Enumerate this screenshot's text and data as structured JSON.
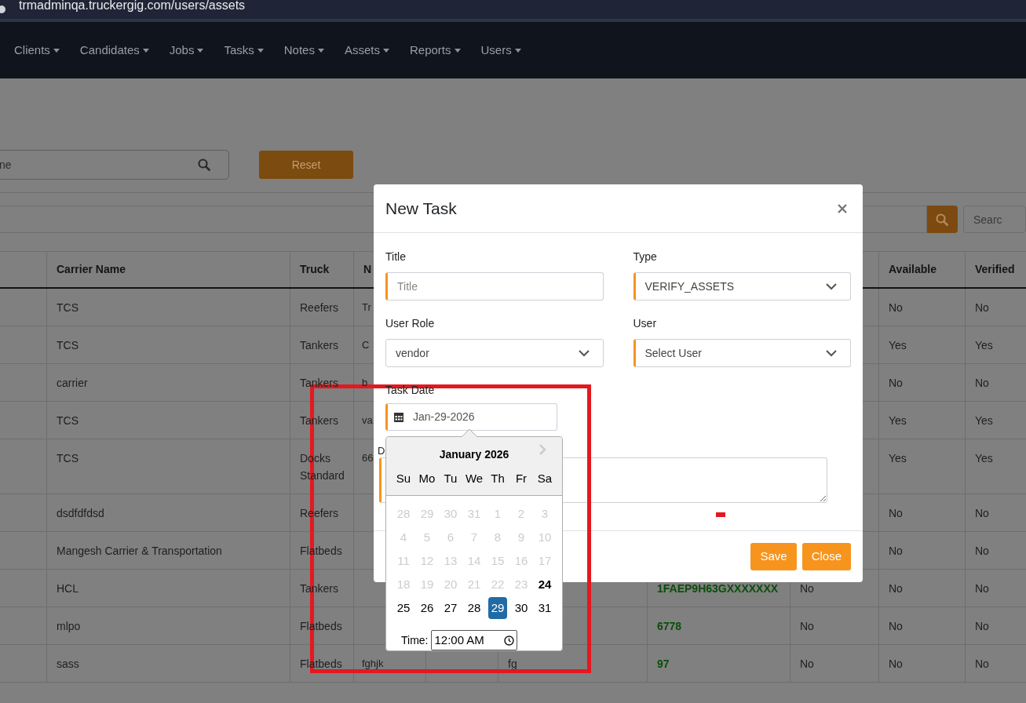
{
  "address_bar": {
    "url": "trmadminqa.truckergig.com/users/assets"
  },
  "nav": {
    "items": [
      {
        "label": "Clients"
      },
      {
        "label": "Candidates"
      },
      {
        "label": "Jobs"
      },
      {
        "label": "Tasks"
      },
      {
        "label": "Notes"
      },
      {
        "label": "Assets"
      },
      {
        "label": "Reports"
      },
      {
        "label": "Users"
      }
    ]
  },
  "filters": {
    "search": {
      "placeholder": "ne"
    },
    "reset_button": "Reset"
  },
  "table_toolbar": {
    "search": {
      "placeholder": "Searc"
    }
  },
  "table": {
    "columns": [
      {},
      {
        "label": "Carrier Name"
      },
      {
        "label": "Truck"
      },
      {
        "label": "N"
      },
      {},
      {},
      {},
      {},
      {
        "label": "Available"
      },
      {
        "label": "Verified"
      }
    ],
    "rows": [
      {
        "cells": [
          null,
          "TCS",
          "Reefers",
          "Tr",
          null,
          null,
          null,
          null,
          "No",
          "No"
        ]
      },
      {
        "cells": [
          null,
          "TCS",
          "Tankers",
          "C",
          null,
          null,
          null,
          null,
          "Yes",
          "Yes"
        ]
      },
      {
        "cells": [
          null,
          "carrier",
          "Tankers",
          "b",
          null,
          null,
          null,
          null,
          "No",
          "No"
        ]
      },
      {
        "cells": [
          null,
          "TCS",
          "Tankers",
          "va",
          null,
          null,
          null,
          null,
          "Yes",
          "Yes"
        ]
      },
      {
        "cells": [
          null,
          "TCS",
          "Docks Standard",
          "66",
          null,
          null,
          null,
          null,
          "Yes",
          "Yes"
        ]
      },
      {
        "cells": [
          null,
          "dsdfdfdsd",
          "Reefers",
          null,
          null,
          null,
          null,
          null,
          "No",
          "No"
        ]
      },
      {
        "cells": [
          null,
          "Mangesh Carrier & Transportation",
          "Flatbeds",
          null,
          null,
          null,
          null,
          null,
          "No",
          "No"
        ]
      },
      {
        "cells": [
          null,
          "HCL",
          "Tankers",
          null,
          null,
          null,
          "1FAEP9H63GXXXXXXX",
          "No",
          "No",
          "No"
        ]
      },
      {
        "cells": [
          null,
          "mlpo",
          "Flatbeds",
          null,
          null,
          null,
          "6778",
          "No",
          "No",
          "No"
        ]
      },
      {
        "cells": [
          null,
          "sass",
          "Flatbeds",
          "fghjk",
          null,
          "fg",
          "97",
          "No",
          "No",
          "No"
        ]
      }
    ]
  },
  "modal": {
    "title": "New Task",
    "fields": [
      {
        "kind": "input",
        "label": "Title",
        "placeholder": "Title",
        "required": true
      },
      {
        "kind": "select",
        "label": "Type",
        "value": "VERIFY_ASSETS",
        "required": true
      },
      {
        "kind": "select",
        "label": "User Role",
        "value": "vendor",
        "required": false
      },
      {
        "kind": "select",
        "label": "User",
        "value": "Select User",
        "required": true
      }
    ],
    "task_date": {
      "label": "Task Date",
      "value": "Jan-29-2026",
      "required": true
    },
    "description": {
      "label": "D",
      "required": true
    },
    "buttons": [
      "Save",
      "Close"
    ]
  },
  "datepicker": {
    "month": "January 2026",
    "weekdays": [
      "Su",
      "Mo",
      "Tu",
      "We",
      "Th",
      "Fr",
      "Sa"
    ],
    "days": [
      {
        "d": "28",
        "disabled": true,
        "today": false,
        "selected": false
      },
      {
        "d": "29",
        "disabled": true,
        "today": false,
        "selected": false
      },
      {
        "d": "30",
        "disabled": true,
        "today": false,
        "selected": false
      },
      {
        "d": "31",
        "disabled": true,
        "today": false,
        "selected": false
      },
      {
        "d": "1",
        "disabled": true,
        "today": false,
        "selected": false
      },
      {
        "d": "2",
        "disabled": true,
        "today": false,
        "selected": false
      },
      {
        "d": "3",
        "disabled": true,
        "today": false,
        "selected": false
      },
      {
        "d": "4",
        "disabled": true,
        "today": false,
        "selected": false
      },
      {
        "d": "5",
        "disabled": true,
        "today": false,
        "selected": false
      },
      {
        "d": "6",
        "disabled": true,
        "today": false,
        "selected": false
      },
      {
        "d": "7",
        "disabled": true,
        "today": false,
        "selected": false
      },
      {
        "d": "8",
        "disabled": true,
        "today": false,
        "selected": false
      },
      {
        "d": "9",
        "disabled": true,
        "today": false,
        "selected": false
      },
      {
        "d": "10",
        "disabled": true,
        "today": false,
        "selected": false
      },
      {
        "d": "11",
        "disabled": true,
        "today": false,
        "selected": false
      },
      {
        "d": "12",
        "disabled": true,
        "today": false,
        "selected": false
      },
      {
        "d": "13",
        "disabled": true,
        "today": false,
        "selected": false
      },
      {
        "d": "14",
        "disabled": true,
        "today": false,
        "selected": false
      },
      {
        "d": "15",
        "disabled": true,
        "today": false,
        "selected": false
      },
      {
        "d": "16",
        "disabled": true,
        "today": false,
        "selected": false
      },
      {
        "d": "17",
        "disabled": true,
        "today": false,
        "selected": false
      },
      {
        "d": "18",
        "disabled": true,
        "today": false,
        "selected": false
      },
      {
        "d": "19",
        "disabled": true,
        "today": false,
        "selected": false
      },
      {
        "d": "20",
        "disabled": true,
        "today": false,
        "selected": false
      },
      {
        "d": "21",
        "disabled": true,
        "today": false,
        "selected": false
      },
      {
        "d": "22",
        "disabled": true,
        "today": false,
        "selected": false
      },
      {
        "d": "23",
        "disabled": true,
        "today": false,
        "selected": false
      },
      {
        "d": "24",
        "disabled": false,
        "today": true,
        "selected": false
      },
      {
        "d": "25",
        "disabled": false,
        "today": false,
        "selected": false
      },
      {
        "d": "26",
        "disabled": false,
        "today": false,
        "selected": false
      },
      {
        "d": "27",
        "disabled": false,
        "today": false,
        "selected": false
      },
      {
        "d": "28",
        "disabled": false,
        "today": false,
        "selected": false
      },
      {
        "d": "29",
        "disabled": false,
        "today": false,
        "selected": true
      },
      {
        "d": "30",
        "disabled": false,
        "today": false,
        "selected": false
      },
      {
        "d": "31",
        "disabled": false,
        "today": false,
        "selected": false
      }
    ],
    "time": {
      "label": "Time:",
      "value": "12:00 AM"
    }
  },
  "annotations": {
    "highlight_box": true,
    "dash_mark": true
  }
}
